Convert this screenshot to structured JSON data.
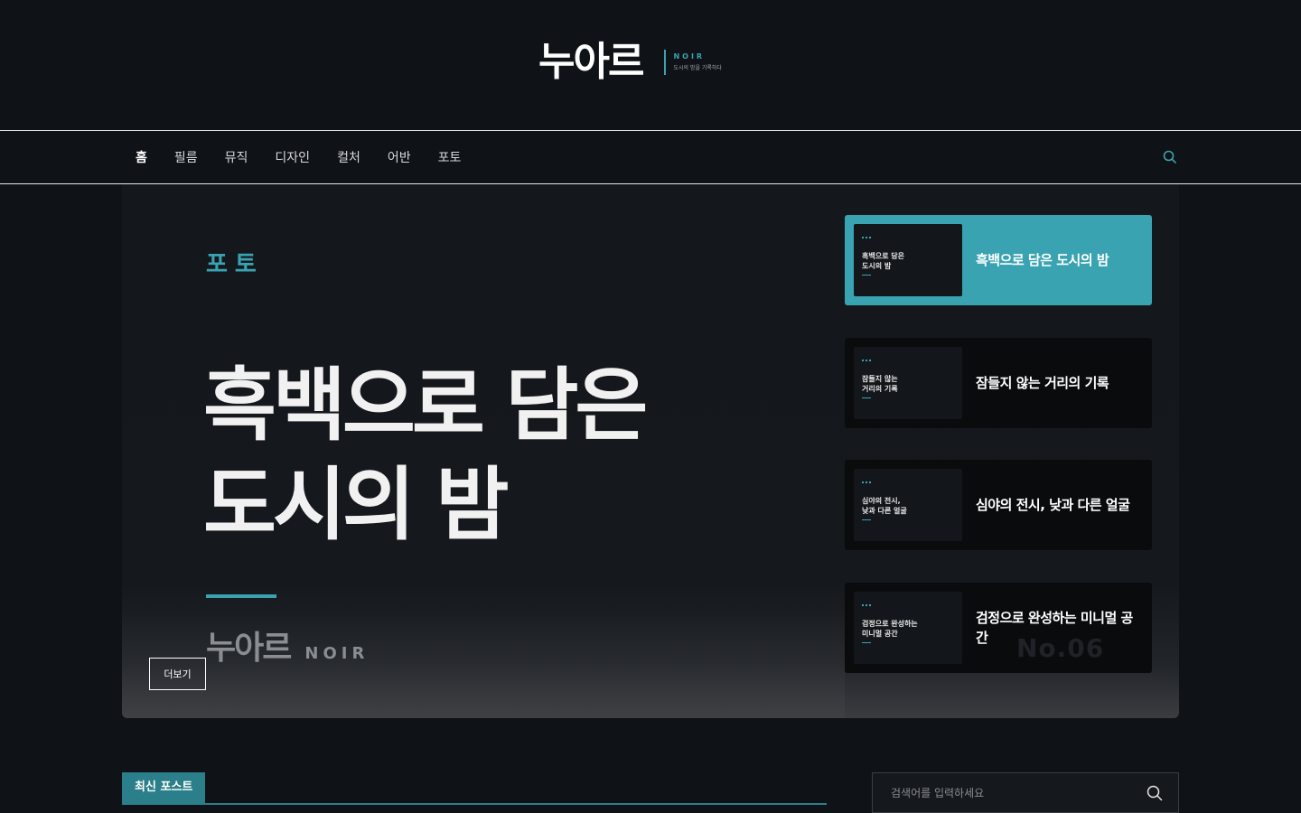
{
  "header": {
    "logo_ko": "누아르",
    "logo_en": "NOIR",
    "tagline": "도시의 밤을 기록하다"
  },
  "nav": {
    "items": [
      {
        "label": "홈",
        "active": true
      },
      {
        "label": "필름"
      },
      {
        "label": "뮤직"
      },
      {
        "label": "디자인"
      },
      {
        "label": "컬처"
      },
      {
        "label": "어반"
      },
      {
        "label": "포토"
      }
    ],
    "search_icon": "search-icon"
  },
  "hero": {
    "category": "포토",
    "title_line1": "흑백으로 담은",
    "title_line2": "도시의 밤",
    "brand_ko": "누아르",
    "brand_en": "NOIR",
    "more_label": "더보기",
    "cards": [
      {
        "thumb_line1": "흑백으로 담은",
        "thumb_line2": "도시의 밤",
        "title": "흑백으로 담은 도시의 밤",
        "active": true
      },
      {
        "thumb_line1": "잠들지 않는",
        "thumb_line2": "거리의 기록",
        "title": "잠들지 않는 거리의 기록"
      },
      {
        "thumb_line1": "심야의 전시,",
        "thumb_line2": "낮과 다른 얼굴",
        "title": "심야의 전시, 낮과 다른 얼굴"
      },
      {
        "thumb_line1": "검정으로 완성하는",
        "thumb_line2": "미니멀 공간",
        "title": "검정으로 완성하는 미니멀 공간",
        "bg_number": "No.06"
      }
    ]
  },
  "latest": {
    "label": "최신 포스트"
  },
  "search": {
    "placeholder": "검색어를 입력하세요"
  },
  "colors": {
    "accent": "#3aa3b1",
    "background": "#0f1216",
    "section_label": "#2b7f8a"
  }
}
